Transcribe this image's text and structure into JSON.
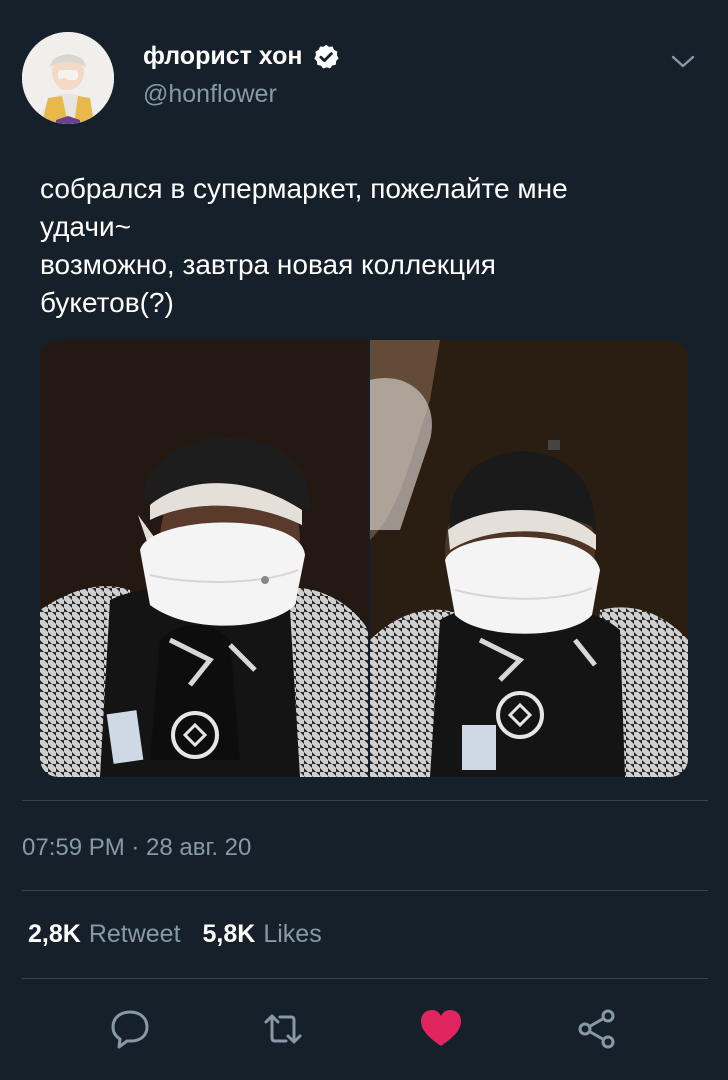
{
  "author": {
    "display_name": "флорист хон",
    "handle": "@honflower",
    "verified": true
  },
  "tweet": {
    "lines": [
      "собрался в супермаркет, пожелайте мне",
      "удачи~",
      "возможно, завтра новая коллекция",
      "букетов(?)"
    ],
    "timestamp": "07:59 PM · 28 авг. 20"
  },
  "stats": {
    "retweets": "2,8K",
    "retweet_label": "Retweet",
    "likes": "5,8K",
    "likes_label": "Likes"
  },
  "actions": {
    "reply": "reply-icon",
    "retweet": "retweet-icon",
    "like": "heart-icon",
    "share": "share-icon"
  },
  "colors": {
    "background": "#15202b",
    "secondary_text": "#8899a6",
    "verified_badge": "#ffffff",
    "like_active": "#e0245e",
    "divider": "#38444d"
  }
}
